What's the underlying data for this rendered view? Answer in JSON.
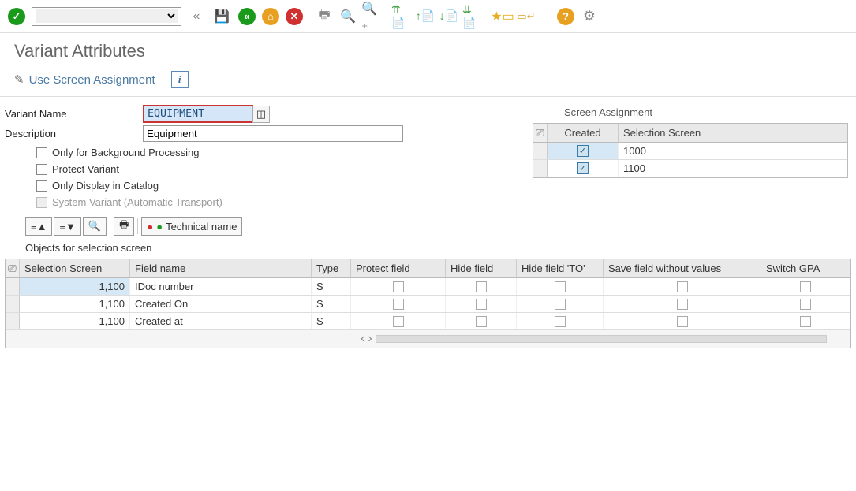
{
  "header": {
    "page_title": "Variant Attributes",
    "sub_link": "Use Screen Assignment"
  },
  "form": {
    "variant_name_label": "Variant Name",
    "variant_name_value": "EQUIPMENT",
    "description_label": "Description",
    "description_value": "Equipment",
    "chk1": "Only for Background Processing",
    "chk2": "Protect Variant",
    "chk3": "Only Display in Catalog",
    "chk4": "System Variant (Automatic Transport)"
  },
  "screen_panel": {
    "title": "Screen Assignment",
    "cols": [
      "Created",
      "Selection Screen"
    ],
    "rows": [
      {
        "created": true,
        "screen": "1000"
      },
      {
        "created": true,
        "screen": "1100"
      }
    ]
  },
  "obj_toolbar": {
    "technical_btn": "Technical name"
  },
  "objects_section_label": "Objects for selection screen",
  "big_grid": {
    "cols": [
      "Selection Screen",
      "Field name",
      "Type",
      "Protect field",
      "Hide field",
      "Hide field 'TO'",
      "Save field without values",
      "Switch GPA"
    ],
    "rows": [
      {
        "screen": "1,100",
        "field": "IDoc number",
        "type": "S"
      },
      {
        "screen": "1,100",
        "field": "Created On",
        "type": "S"
      },
      {
        "screen": "1,100",
        "field": "Created at",
        "type": "S"
      }
    ]
  }
}
